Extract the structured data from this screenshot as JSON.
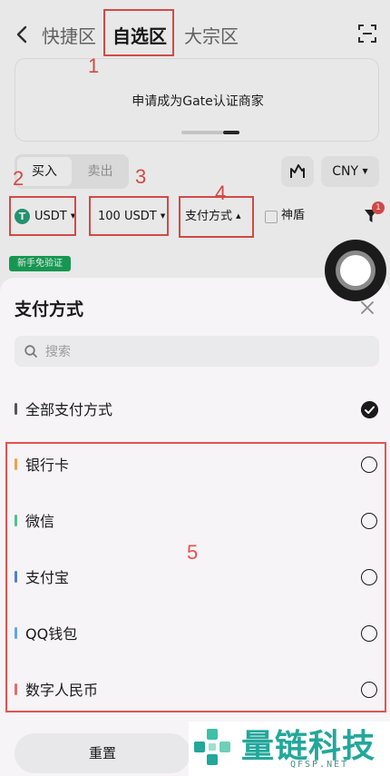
{
  "nav": {
    "tabs": [
      "快捷区",
      "自选区",
      "大宗区"
    ],
    "active_tab": "自选区"
  },
  "banner": {
    "text": "申请成为Gate认证商家"
  },
  "trade_toggle": {
    "buy_label": "买入",
    "sell_label": "卖出",
    "selected": "买入"
  },
  "currency_selector": {
    "value": "CNY"
  },
  "filters": {
    "coin": "USDT",
    "amount": "100 USDT",
    "payment_method": "支付方式",
    "shield_label": "神盾",
    "filter_badge_count": "1"
  },
  "newbie_badge": "新手免验证",
  "payment_sheet": {
    "title": "支付方式",
    "search_placeholder": "搜索",
    "items": [
      {
        "label": "全部支付方式",
        "color": "#555555",
        "selected": true
      },
      {
        "label": "银行卡",
        "color": "#f0a04a",
        "selected": false
      },
      {
        "label": "微信",
        "color": "#4fc08d",
        "selected": false
      },
      {
        "label": "支付宝",
        "color": "#4f7fd8",
        "selected": false
      },
      {
        "label": "QQ钱包",
        "color": "#5aa9e6",
        "selected": false
      },
      {
        "label": "数字人民币",
        "color": "#e86a6a",
        "selected": false
      }
    ],
    "reset_label": "重置"
  },
  "annotations": [
    "1",
    "2",
    "3",
    "4",
    "5"
  ],
  "watermark": {
    "title": "量链科技",
    "subtitle": "QFSP.NET"
  },
  "colors": {
    "annotation_red": "#e8514f",
    "usdt_green": "#26a17b",
    "newbie_green": "#19a75a",
    "watermark_teal": "#23a79a"
  }
}
